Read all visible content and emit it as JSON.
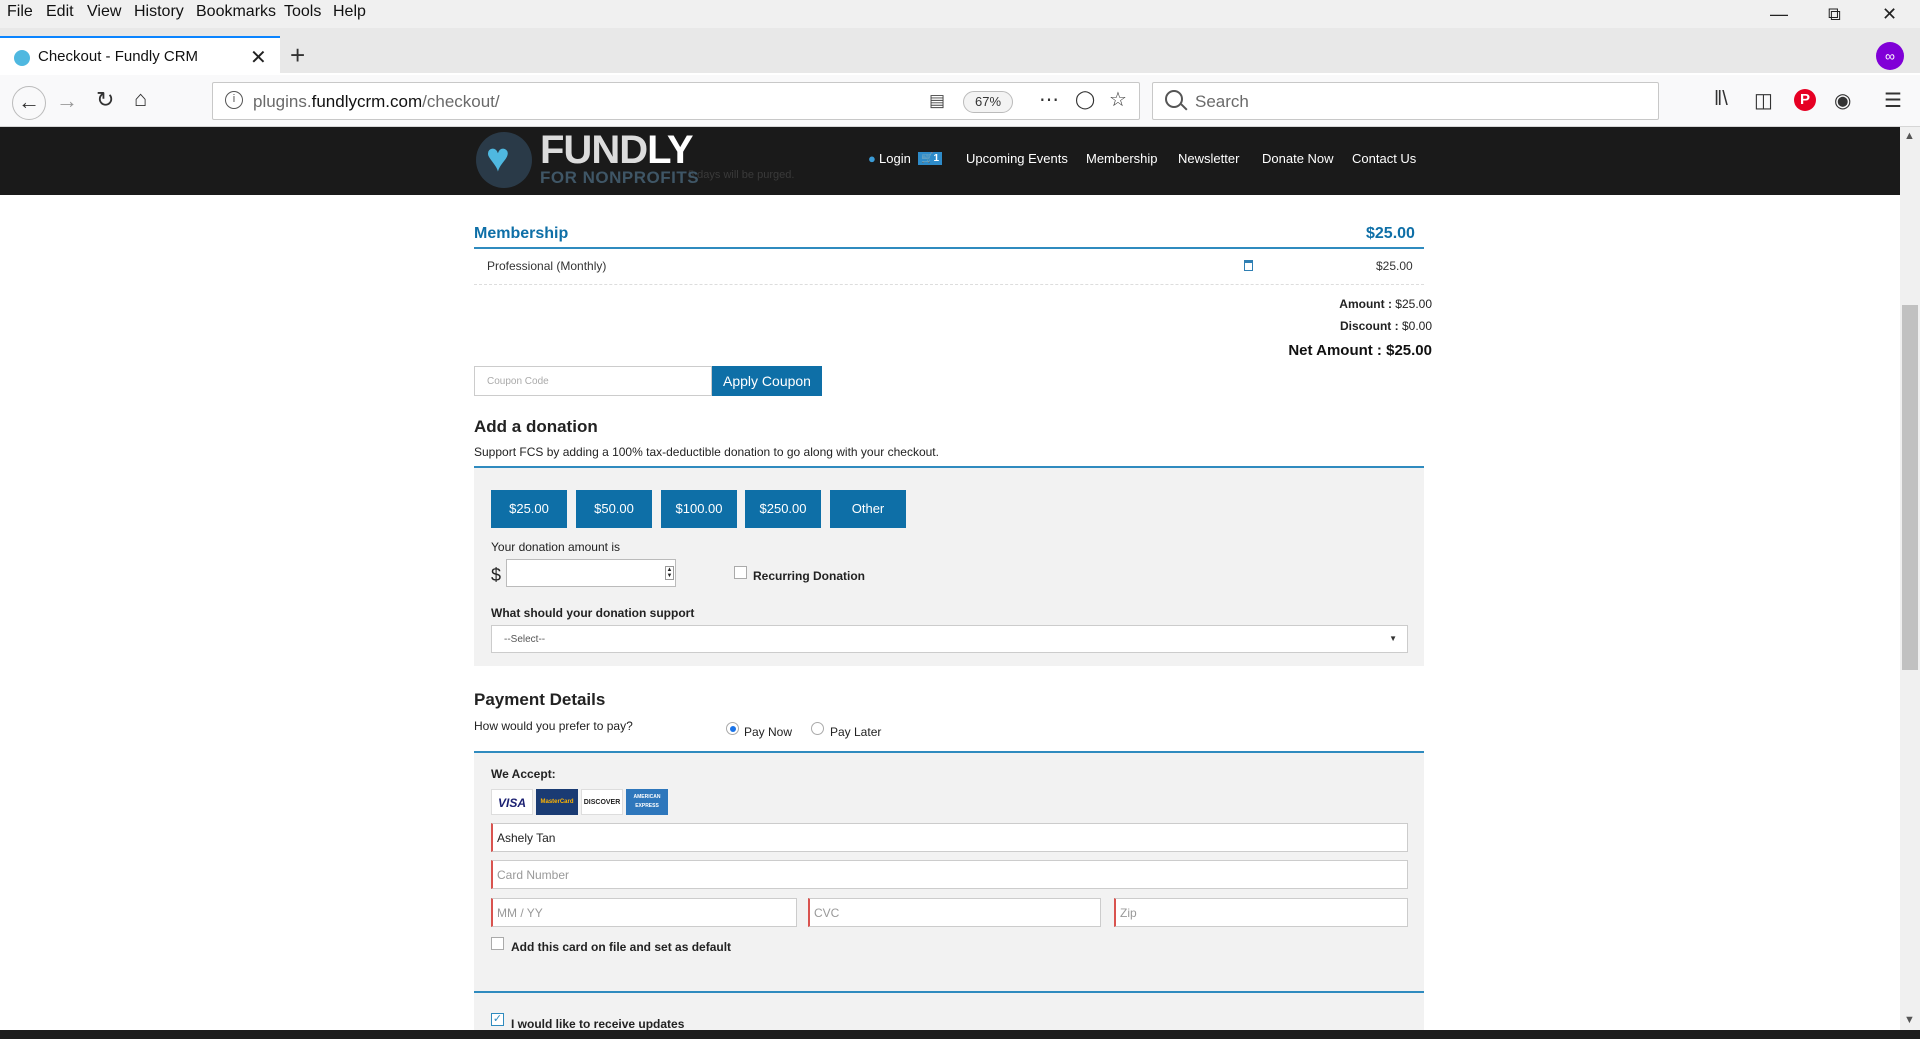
{
  "browser": {
    "menu": [
      "File",
      "Edit",
      "View",
      "History",
      "Bookmarks",
      "Tools",
      "Help"
    ],
    "tab_title": "Checkout - Fundly CRM",
    "url_domain_pre": "plugins.",
    "url_domain": "fundlycrm.com",
    "url_path": "/checkout/",
    "zoom": "67%",
    "search_placeholder": "Search"
  },
  "site": {
    "logo_fund": "FUND",
    "logo_ly": "LY",
    "logo_sub": "FOR NONPROFITS",
    "ghost_text": "5 days will be purged.",
    "nav": {
      "login": "Login",
      "cart_count": "1",
      "upcoming_events": "Upcoming Events",
      "membership": "Membership",
      "newsletter": "Newsletter",
      "donate_now": "Donate Now",
      "contact_us": "Contact Us"
    }
  },
  "cart": {
    "section_title": "Membership",
    "section_total": "$25.00",
    "item_name": "Professional (Monthly)",
    "item_price": "$25.00",
    "amount_label": "Amount :",
    "amount_value": "$25.00",
    "discount_label": "Discount :",
    "discount_value": "$0.00",
    "net_label": "Net Amount :",
    "net_value": "$25.00",
    "coupon_placeholder": "Coupon Code",
    "apply_coupon": "Apply Coupon"
  },
  "donation": {
    "title": "Add a donation",
    "subtitle": "Support FCS by adding a 100% tax-deductible donation to go along with your checkout.",
    "amounts": [
      "$25.00",
      "$50.00",
      "$100.00",
      "$250.00",
      "Other"
    ],
    "amount_label": "Your donation amount is",
    "currency": "$",
    "recurring_label": "Recurring Donation",
    "support_label": "What should your donation support",
    "support_selected": "--Select--"
  },
  "payment": {
    "title": "Payment Details",
    "prefer_label": "How would you prefer to pay?",
    "pay_now": "Pay Now",
    "pay_later": "Pay Later",
    "we_accept": "We Accept:",
    "cards": [
      "VISA",
      "MasterCard",
      "DISCOVER",
      "AMERICAN EXPRESS"
    ],
    "name_value": "Ashely Tan",
    "card_number_placeholder": "Card Number",
    "exp_placeholder": "MM / YY",
    "cvc_placeholder": "CVC",
    "zip_placeholder": "Zip",
    "save_card_label": "Add this card on file and set as default",
    "updates_label": "I would like to receive updates"
  }
}
